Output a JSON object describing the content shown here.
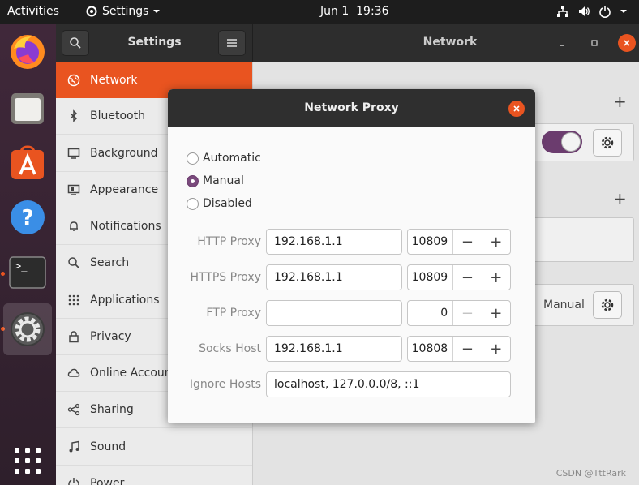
{
  "topbar": {
    "activities": "Activities",
    "app_name": "Settings",
    "date": "Jun 1",
    "time": "19:36"
  },
  "dock": {
    "apps": [
      {
        "name": "firefox-icon"
      },
      {
        "name": "files-icon"
      },
      {
        "name": "software-icon"
      },
      {
        "name": "help-icon"
      },
      {
        "name": "terminal-icon"
      },
      {
        "name": "settings-icon"
      },
      {
        "name": "app-grid-icon"
      }
    ]
  },
  "sidebar_header": {
    "title": "Settings"
  },
  "main_header": {
    "title": "Network"
  },
  "sidebar": {
    "items": [
      {
        "label": "Network",
        "icon": "network-icon"
      },
      {
        "label": "Bluetooth",
        "icon": "bluetooth-icon"
      },
      {
        "label": "Background",
        "icon": "background-icon"
      },
      {
        "label": "Appearance",
        "icon": "appearance-icon"
      },
      {
        "label": "Notifications",
        "icon": "bell-icon"
      },
      {
        "label": "Search",
        "icon": "search-icon"
      },
      {
        "label": "Applications",
        "icon": "apps-icon"
      },
      {
        "label": "Privacy",
        "icon": "lock-icon"
      },
      {
        "label": "Online Accounts",
        "icon": "cloud-icon"
      },
      {
        "label": "Sharing",
        "icon": "share-icon"
      },
      {
        "label": "Sound",
        "icon": "music-icon"
      },
      {
        "label": "Power",
        "icon": "power-icon"
      }
    ]
  },
  "main": {
    "proxy_value": "Manual"
  },
  "dialog": {
    "title": "Network Proxy",
    "modes": [
      {
        "label": "Automatic",
        "selected": false
      },
      {
        "label": "Manual",
        "selected": true
      },
      {
        "label": "Disabled",
        "selected": false
      }
    ],
    "fields": {
      "http": {
        "label": "HTTP Proxy",
        "host": "192.168.1.1",
        "port": "10809"
      },
      "https": {
        "label": "HTTPS Proxy",
        "host": "192.168.1.1",
        "port": "10809"
      },
      "ftp": {
        "label": "FTP Proxy",
        "host": "",
        "port": "0"
      },
      "socks": {
        "label": "Socks Host",
        "host": "192.168.1.1",
        "port": "10808"
      },
      "ignore": {
        "label": "Ignore Hosts",
        "value": "localhost, 127.0.0.0/8, ::1"
      }
    },
    "minus": "−",
    "plus": "+"
  },
  "watermark": "CSDN @TttRark",
  "colors": {
    "accent": "#e95420",
    "toggle_on": "#6b3c6e"
  }
}
